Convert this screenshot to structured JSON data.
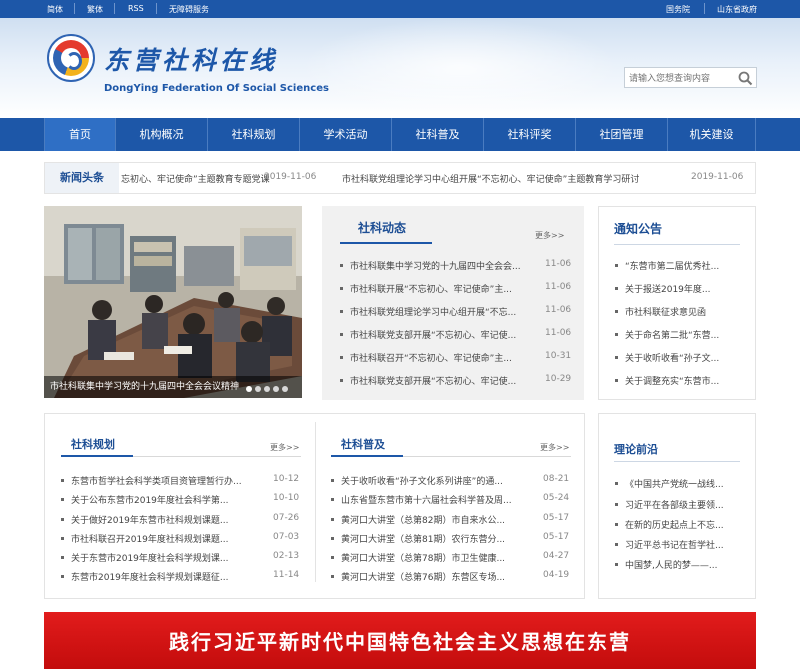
{
  "topbar": {
    "links_left": [
      "简体",
      "繁体",
      "RSS",
      "无障碍服务"
    ],
    "links_right": [
      "国务院",
      "山东省政府"
    ]
  },
  "header": {
    "site_name_cn": "东营社科在线",
    "site_name_en": "DongYing Federation Of Social Sciences",
    "logo_icon": "federation-emblem-icon"
  },
  "search": {
    "placeholder": "请输入您想查询内容",
    "icon": "search-icon"
  },
  "nav": {
    "items": [
      "首页",
      "机构概况",
      "社科规划",
      "学术活动",
      "社科普及",
      "社科评奖",
      "社团管理",
      "机关建设"
    ]
  },
  "news": {
    "label": "新闻头条",
    "items": [
      {
        "title": "忘初心、牢记使命”主题教育专题党课",
        "date": "2019-11-06"
      },
      {
        "title": "市社科联党组理论学习中心组开展“不忘初心、牢记使命”主题教育学习研讨",
        "date": "2019-11-06"
      }
    ]
  },
  "carousel": {
    "caption": "市社科联集中学习党的十九届四中全会会议精神",
    "active_slide": 1,
    "slide_count": 5
  },
  "dynamics": {
    "title": "社科动态",
    "more": "更多>>",
    "items": [
      {
        "title": "市社科联集中学习党的十九届四中全会会...",
        "date": "11-06"
      },
      {
        "title": "市社科联开展“不忘初心、牢记使命”主...",
        "date": "11-06"
      },
      {
        "title": "市社科联党组理论学习中心组开展“不忘...",
        "date": "11-06"
      },
      {
        "title": "市社科联党支部开展“不忘初心、牢记使...",
        "date": "11-06"
      },
      {
        "title": "市社科联召开“不忘初心、牢记使命”主...",
        "date": "10-31"
      },
      {
        "title": "市社科联党支部开展“不忘初心、牢记使...",
        "date": "10-29"
      }
    ]
  },
  "notice": {
    "title": "通知公告",
    "items": [
      "“东营市第二届优秀社...",
      "关于报送2019年度...",
      "市社科联征求意见函",
      "关于命名第二批“东营...",
      "关于收听收看“孙子文...",
      "关于调整充实“东营市..."
    ]
  },
  "planning": {
    "title": "社科规划",
    "more": "更多>>",
    "items": [
      {
        "title": "东营市哲学社会科学类项目资管理暂行办...",
        "date": "10-12"
      },
      {
        "title": "关于公布东营市2019年度社会科学第...",
        "date": "10-10"
      },
      {
        "title": "关于做好2019年东营市社科规划课题...",
        "date": "07-26"
      },
      {
        "title": "市社科联召开2019年度社科规划课题...",
        "date": "07-03"
      },
      {
        "title": "关于东营市2019年度社会科学规划课...",
        "date": "02-13"
      },
      {
        "title": "东营市2019年度社会科学规划课题征...",
        "date": "11-14"
      }
    ]
  },
  "popularization": {
    "title": "社科普及",
    "more": "更多>>",
    "items": [
      {
        "title": "关于收听收看“孙子文化系列讲座”的通...",
        "date": "08-21"
      },
      {
        "title": "山东省暨东营市第十六届社会科学普及周...",
        "date": "05-24"
      },
      {
        "title": "黄河口大讲堂（总第82期）市自来水公...",
        "date": "05-17"
      },
      {
        "title": "黄河口大讲堂（总第81期）农行东营分...",
        "date": "05-17"
      },
      {
        "title": "黄河口大讲堂（总第78期）市卫生健康...",
        "date": "04-27"
      },
      {
        "title": "黄河口大讲堂（总第76期）东营区专场...",
        "date": "04-19"
      }
    ]
  },
  "theory": {
    "title": "理论前沿",
    "items": [
      "《中国共产党统一战线...",
      "习近平在各部级主要领...",
      "在新的历史起点上不忘...",
      "习近平总书记在哲学社...",
      "中国梦,人民的梦——..."
    ]
  },
  "banner": {
    "text": "践行习近平新时代中国特色社会主义思想在东营"
  },
  "colors": {
    "primary": "#1d57a8",
    "banner": "#d81414"
  }
}
